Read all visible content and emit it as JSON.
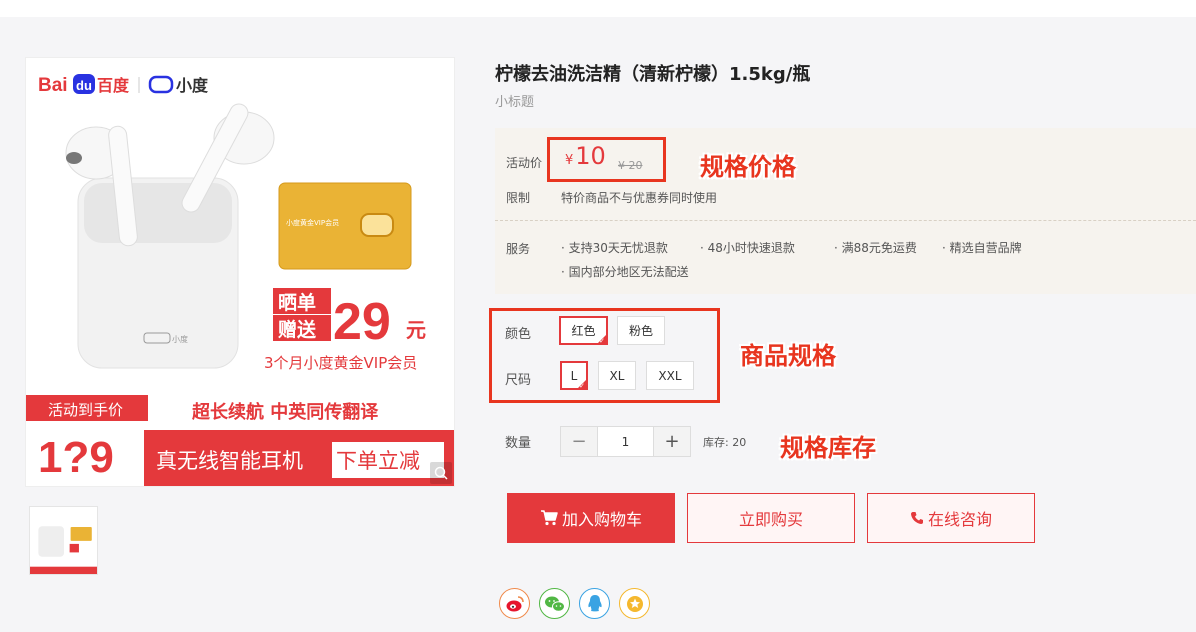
{
  "product": {
    "title": "柠檬去油洗洁精（清新柠檬）1.5kg/瓶",
    "subtitle": "小标题"
  },
  "banner": {
    "brand_baidu": "Bai",
    "brand_du": "du",
    "brand_cn": "百度",
    "brand_xiaodu": "小度",
    "card_text": "小度黄金VIP会员",
    "promo_line1": "晒单",
    "promo_line2": "赠送",
    "promo_amount": "29",
    "promo_unit": "元",
    "vip_text": "3个月小度黄金VIP会员",
    "case_logo": "小度",
    "tag_text": "活动到手价",
    "feature_text": "超长续航 中英同传翻译",
    "price_big": "1?9",
    "product_name": "真无线智能耳机",
    "cta_text": "下单立减"
  },
  "price": {
    "label": "活动价",
    "currency": "¥",
    "current": "10",
    "original_currency": "¥",
    "original": "20",
    "limit_label": "限制",
    "limit_text": "特价商品不与优惠券同时使用",
    "service_label": "服务",
    "services": [
      "· 支持30天无忧退款",
      "· 48小时快速退款",
      "· 满88元免运费",
      "· 精选自营品牌",
      "· 国内部分地区无法配送"
    ]
  },
  "sku": {
    "color_label": "颜色",
    "colors": [
      "红色",
      "粉色"
    ],
    "size_label": "尺码",
    "sizes": [
      "L",
      "XL",
      "XXL"
    ]
  },
  "quantity": {
    "label": "数量",
    "minus": "−",
    "value": "1",
    "plus": "+",
    "stock": "库存: 20"
  },
  "actions": {
    "add_to_cart": "加入购物车",
    "buy_now": "立即购买",
    "consult": "在线咨询"
  },
  "annotations": {
    "price": "规格价格",
    "spec": "商品规格",
    "stock": "规格库存"
  },
  "colors": {
    "accent": "#e4393c",
    "annotation": "#e8351f",
    "panel_bg": "#f6f3ee"
  },
  "icons": [
    "cart-icon",
    "phone-icon",
    "weibo-icon",
    "wechat-icon",
    "qq-icon",
    "favorite-icon",
    "zoom-icon",
    "check-icon"
  ]
}
